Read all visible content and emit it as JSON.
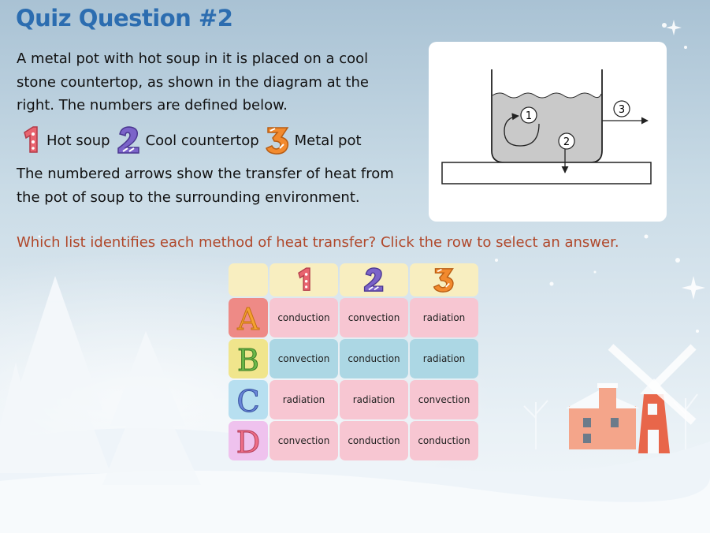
{
  "page_title": "Quiz Question #2",
  "intro": "A metal pot with hot soup in it is placed on a cool stone countertop, as shown in the diagram at the right. The numbers are defined below.",
  "legend": [
    {
      "number": "1",
      "label": "Hot soup",
      "color": "#e8646f"
    },
    {
      "number": "2",
      "label": "Cool countertop",
      "color": "#7b63c9"
    },
    {
      "number": "3",
      "label": "Metal pot",
      "color": "#f28a2e"
    }
  ],
  "paragraph2": "The numbered arrows show the transfer of heat from the pot of soup to the surrounding environment.",
  "diagram": {
    "labels": [
      "1",
      "2",
      "3"
    ]
  },
  "question": "Which list identifies each method of heat transfer? Click the row to select an answer.",
  "table": {
    "header_numbers": [
      "1",
      "2",
      "3"
    ],
    "rows": [
      {
        "letter": "A",
        "values": [
          "conduction",
          "convection",
          "radiation"
        ]
      },
      {
        "letter": "B",
        "values": [
          "convection",
          "conduction",
          "radiation"
        ]
      },
      {
        "letter": "C",
        "values": [
          "radiation",
          "radiation",
          "convection"
        ]
      },
      {
        "letter": "D",
        "values": [
          "convection",
          "conduction",
          "conduction"
        ]
      }
    ]
  },
  "colors": {
    "title": "#2c6db0",
    "question": "#b0472a",
    "row_pink": "#f7c6d2",
    "row_blue": "#acd7e4",
    "header": "#f8eec0"
  }
}
